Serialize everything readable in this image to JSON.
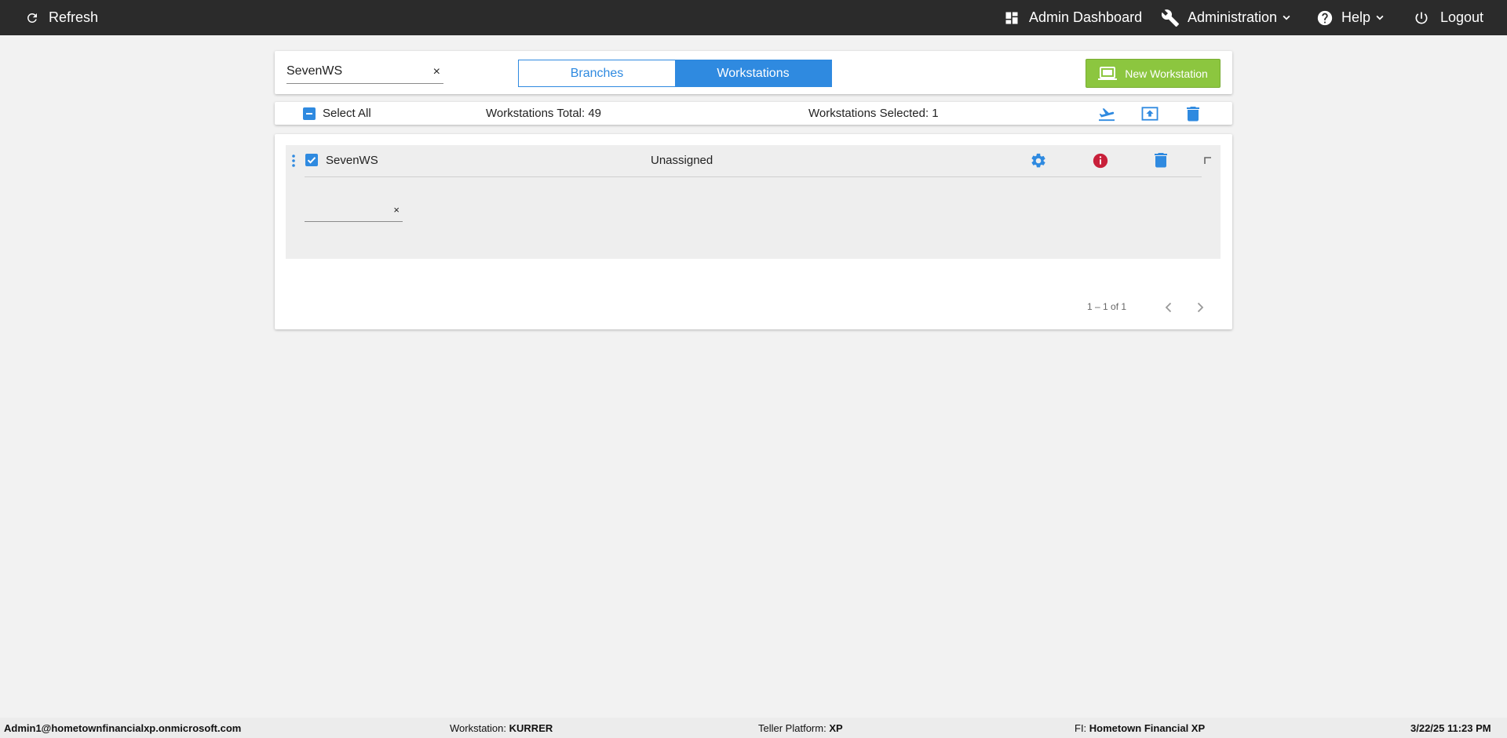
{
  "topbar": {
    "refresh_label": "Refresh",
    "admin_dashboard_label": "Admin Dashboard",
    "administration_label": "Administration",
    "help_label": "Help",
    "logout_label": "Logout"
  },
  "search": {
    "value": "SevenWS",
    "clear": "×"
  },
  "toggle": {
    "branches_label": "Branches",
    "workstations_label": "Workstations",
    "active": "Workstations"
  },
  "new_workstation_label": "New Workstation",
  "bar": {
    "select_all_label": "Select All",
    "total_label": "Workstations Total: 49",
    "selected_label": "Workstations Selected: 1"
  },
  "rows": [
    {
      "name": "SevenWS",
      "status": "Unassigned",
      "checked": true,
      "field_value": "",
      "field_clear": "×"
    }
  ],
  "pager": {
    "range_label": "1 – 1 of 1"
  },
  "footer": {
    "user": "Admin1@hometownfinancialxp.onmicrosoft.com",
    "workstation_label": "Workstation:",
    "workstation_value": "KURRER",
    "platform_label": "Teller Platform:",
    "platform_value": "XP",
    "fi_label": "FI:",
    "fi_value": "Hometown Financial XP",
    "datetime": "3/22/25 11:23 PM"
  },
  "colors": {
    "topbar_bg": "#2b2b2b",
    "accent_blue": "#2f8ae0",
    "new_button_green": "#8cc63f",
    "info_red": "#c8203a"
  },
  "icons": [
    "refresh-icon",
    "dashboard-icon",
    "wrench-icon",
    "help-circle-icon",
    "power-icon",
    "laptop-icon",
    "airplane-icon",
    "upload-icon",
    "trash-icon",
    "gear-icon",
    "info-icon",
    "kebab-icon",
    "chevron-left-icon",
    "chevron-right-icon"
  ]
}
